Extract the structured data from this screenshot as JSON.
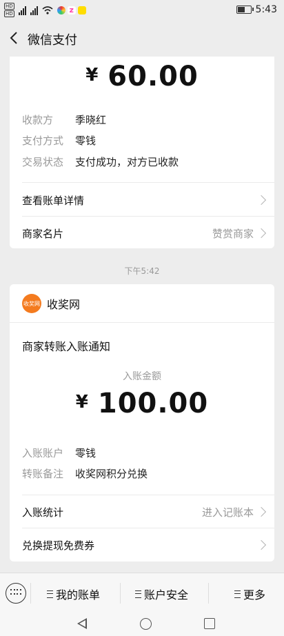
{
  "status_bar": {
    "hd1": "HD",
    "hd2": "HD",
    "time": "5:43",
    "battery_level": 0.5
  },
  "title_bar": {
    "title": "微信支付"
  },
  "payment_card": {
    "currency": "¥",
    "amount": "60.00",
    "fields": [
      {
        "key": "收款方",
        "value": "季晓红"
      },
      {
        "key": "支付方式",
        "value": "零钱"
      },
      {
        "key": "交易状态",
        "value": "支付成功，对方已收款"
      }
    ],
    "view_details": "查看账单详情",
    "merchant_card_label": "商家名片",
    "merchant_card_action": "赞赏商家"
  },
  "time_label": "下午5:42",
  "notice_card": {
    "merchant_logo_text": "收奖网",
    "merchant_name": "收奖网",
    "title": "商家转账入账通知",
    "amount_label": "入账金额",
    "currency": "¥",
    "amount": "100.00",
    "fields": [
      {
        "key": "入账账户",
        "value": "零钱"
      },
      {
        "key": "转账备注",
        "value": "收奖网积分兑换"
      }
    ],
    "stats_label": "入账统计",
    "stats_action": "进入记账本",
    "coupon_label": "兑换提现免费券"
  },
  "bottom_menu": {
    "items": [
      {
        "label": "我的账单"
      },
      {
        "label": "账户安全"
      },
      {
        "label": "更多"
      }
    ]
  },
  "colors": {
    "accent_logo": "#f47b1f",
    "background": "#ededed",
    "card": "#ffffff"
  }
}
